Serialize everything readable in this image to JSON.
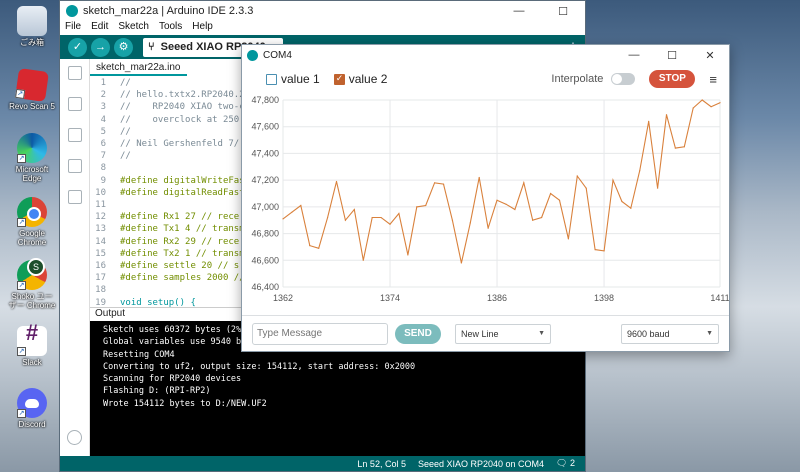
{
  "desktop": {
    "icons": [
      {
        "label": "ごみ箱"
      },
      {
        "label": "Revo Scan 5"
      },
      {
        "label": "Microsoft Edge"
      },
      {
        "label": "Google Chrome"
      },
      {
        "label": "Shoko ユーザー Chrome"
      },
      {
        "label": "Slack"
      },
      {
        "label": "Discord"
      }
    ]
  },
  "ide": {
    "title": "sketch_mar22a | Arduino IDE 2.3.3",
    "menu": [
      "File",
      "Edit",
      "Sketch",
      "Tools",
      "Help"
    ],
    "board": "Seeed XIAO RP2040",
    "file_tab": "sketch_mar22a.ino",
    "code_lines": [
      {
        "n": "1",
        "t": "//"
      },
      {
        "n": "2",
        "t": "// hello.txtx2.RP2040.2"
      },
      {
        "n": "3",
        "t": "//    RP2040 XIAO two-c"
      },
      {
        "n": "4",
        "t": "//    overclock at 250"
      },
      {
        "n": "5",
        "t": "//"
      },
      {
        "n": "6",
        "t": "// Neil Gershenfeld 7/"
      },
      {
        "n": "7",
        "t": "//"
      },
      {
        "n": "8",
        "t": ""
      },
      {
        "n": "9",
        "t": "#define digitalWriteFas"
      },
      {
        "n": "10",
        "t": "#define digitalReadFast"
      },
      {
        "n": "11",
        "t": ""
      },
      {
        "n": "12",
        "t": "#define Rx1 27 // rece"
      },
      {
        "n": "13",
        "t": "#define Tx1 4 // transm"
      },
      {
        "n": "14",
        "t": "#define Rx2 29 // rece"
      },
      {
        "n": "15",
        "t": "#define Tx2 1 // transm"
      },
      {
        "n": "16",
        "t": "#define settle 20 // s"
      },
      {
        "n": "17",
        "t": "#define samples 2000 //"
      },
      {
        "n": "18",
        "t": ""
      },
      {
        "n": "19",
        "t": "void setup() {"
      }
    ],
    "output_label": "Output",
    "output_lines": [
      "Sketch uses 60372 bytes (2%)",
      "Global variables use 9540 byt",
      "Resetting COM4",
      "Converting to uf2, output size: 154112, start address: 0x2000",
      "Scanning for RP2040 devices",
      "Flashing D: (RPI-RP2)",
      "Wrote 154112 bytes to D:/NEW.UF2"
    ],
    "status": {
      "position": "Ln 52, Col 5",
      "board_port": "Seeed XIAO RP2040 on COM4",
      "notifications": "2"
    }
  },
  "plotter": {
    "title": "COM4",
    "legend": [
      {
        "label": "value 1",
        "checked": false,
        "color": "#4a8fb1"
      },
      {
        "label": "value 2",
        "checked": true,
        "color": "#c0622e"
      }
    ],
    "interpolate_label": "Interpolate",
    "stop_label": "STOP",
    "message_placeholder": "Type Message",
    "send_label": "SEND",
    "line_ending": "New Line",
    "baud": "9600 baud"
  },
  "chart_data": {
    "type": "line",
    "xlim": [
      1362,
      1411
    ],
    "ylim": [
      46400,
      47800
    ],
    "xticks": [
      "1362",
      "1374",
      "1386",
      "1398",
      "1411"
    ],
    "yticks": [
      "46,400",
      "46,600",
      "46,800",
      "47,000",
      "47,200",
      "47,400",
      "47,600",
      "47,800"
    ],
    "grid": true,
    "series": [
      {
        "name": "value 2",
        "color": "#d9813c",
        "x": [
          1362,
          1363,
          1364,
          1365,
          1366,
          1367,
          1368,
          1369,
          1370,
          1371,
          1372,
          1373,
          1374,
          1375,
          1376,
          1377,
          1378,
          1379,
          1380,
          1381,
          1382,
          1383,
          1384,
          1385,
          1386,
          1387,
          1388,
          1389,
          1390,
          1391,
          1392,
          1393,
          1394,
          1395,
          1396,
          1397,
          1398,
          1399,
          1400,
          1401,
          1402,
          1403,
          1404,
          1405,
          1406,
          1407,
          1408,
          1409,
          1410,
          1411
        ],
        "values": [
          46910,
          46960,
          47010,
          46710,
          46690,
          46920,
          47190,
          46900,
          46980,
          46600,
          46920,
          46920,
          46870,
          46950,
          46640,
          47000,
          47010,
          47180,
          47170,
          46900,
          46580,
          46880,
          47220,
          46840,
          47050,
          47020,
          46980,
          47180,
          46900,
          46920,
          47100,
          47050,
          46760,
          47230,
          47140,
          46680,
          46670,
          47200,
          47040,
          46990,
          47270,
          47640,
          47140,
          47690,
          47440,
          47450,
          47740,
          47800,
          47750,
          47780
        ]
      }
    ]
  }
}
